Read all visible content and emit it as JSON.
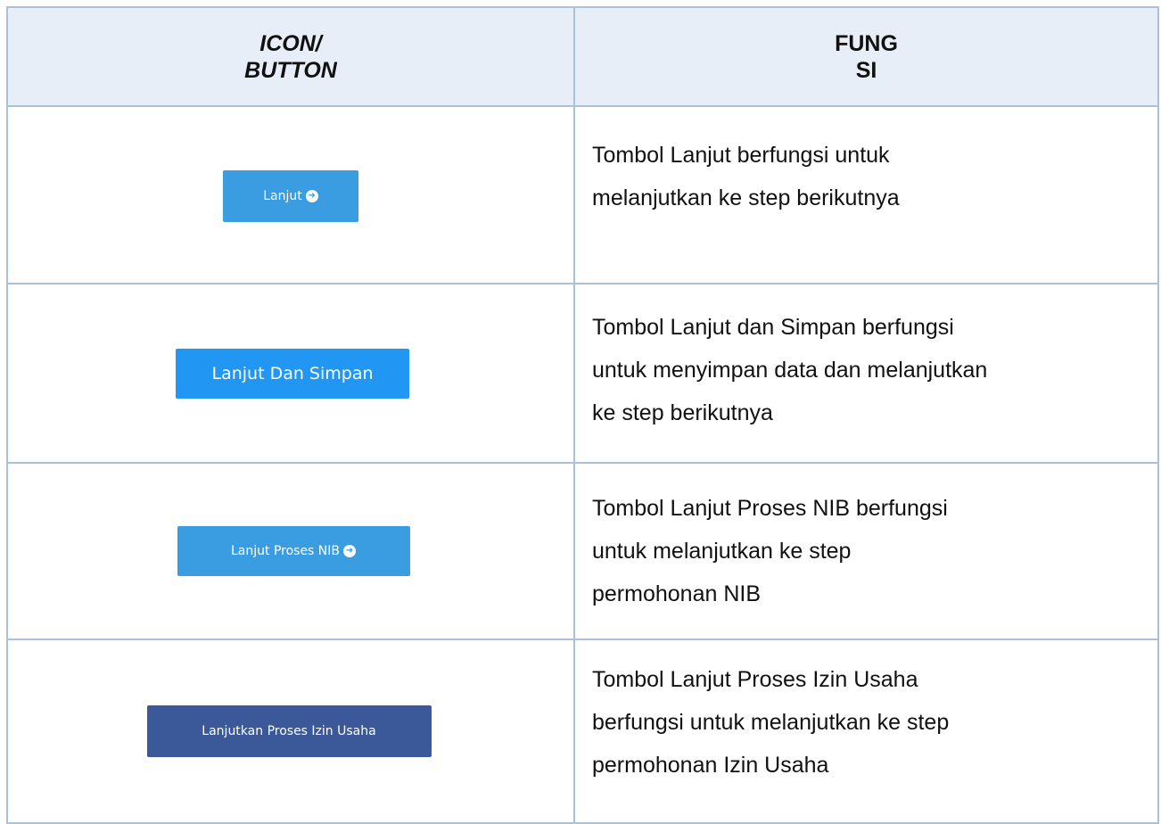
{
  "table": {
    "header": {
      "icon_line1": "ICON/",
      "icon_line2": "BUTTON",
      "func_line1": "FUNG",
      "func_line2": "SI"
    },
    "rows": [
      {
        "button_label": "Lanjut",
        "button_icon": "arrow-circle-right-icon",
        "button_color": "#3a9de2",
        "description_lines": [
          "Tombol Lanjut berfungsi untuk",
          "melanjutkan ke step berikutnya"
        ]
      },
      {
        "button_label": "Lanjut Dan Simpan",
        "button_color": "#2196f3",
        "description_lines": [
          "Tombol Lanjut dan Simpan berfungsi",
          "untuk menyimpan data dan melanjutkan",
          "ke step berikutnya"
        ]
      },
      {
        "button_label": "Lanjut Proses NIB",
        "button_icon": "arrow-circle-right-icon",
        "button_color": "#3a9de2",
        "description_lines": [
          "Tombol Lanjut Proses NIB berfungsi",
          "untuk melanjutkan ke step",
          "permohonan NIB"
        ]
      },
      {
        "button_label": "Lanjutkan Proses Izin Usaha",
        "button_color": "#3b5998",
        "description_lines": [
          "Tombol Lanjut Proses Izin Usaha",
          "berfungsi untuk melanjutkan ke step",
          "permohonan Izin Usaha"
        ]
      }
    ]
  },
  "colors": {
    "header_background": "#e7eef7",
    "border": "#a9c1db"
  }
}
